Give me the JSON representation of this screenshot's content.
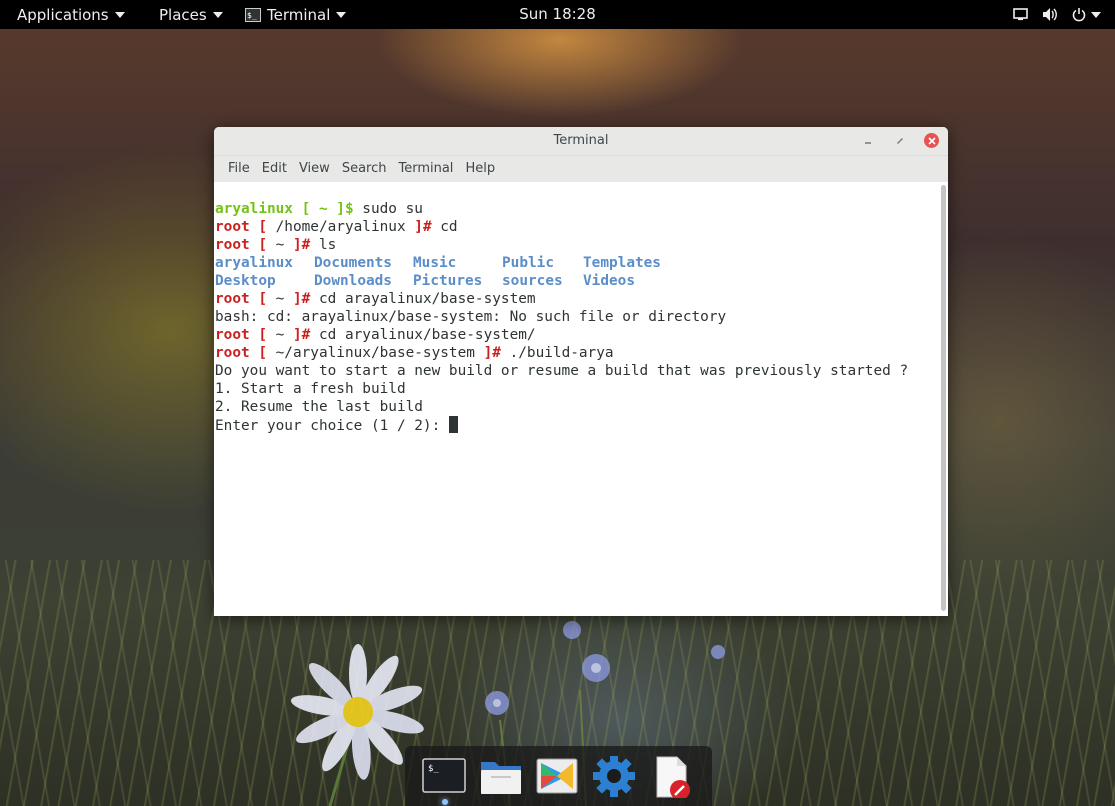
{
  "topbar": {
    "applications": "Applications",
    "places": "Places",
    "app_name": "Terminal",
    "clock": "Sun 18:28",
    "tray_icons": [
      "display-icon",
      "volume-icon",
      "power-icon"
    ]
  },
  "window": {
    "title": "Terminal",
    "menu": [
      "File",
      "Edit",
      "View",
      "Search",
      "Terminal",
      "Help"
    ]
  },
  "terminal": {
    "l1_user": "aryalinux",
    "l1_bracket": " [ ~ ]$",
    "l1_cmd": " sudo su",
    "root": "root",
    "open_br": " [",
    "close_br": "]#",
    "l2_path": " /home/aryalinux ",
    "l2_cmd": " cd",
    "home_path": " ~ ",
    "l3_cmd": " ls",
    "ls_row1": [
      "aryalinux",
      "Documents",
      "Music",
      "Public",
      "Templates"
    ],
    "ls_row2": [
      "Desktop",
      "Downloads",
      "Pictures",
      "sources",
      "Videos"
    ],
    "l6_cmd": " cd arayalinux/base-system",
    "l7_err": "bash: cd: arayalinux/base-system: No such file or directory",
    "l8_cmd": " cd aryalinux/base-system/",
    "l9_path": " ~/aryalinux/base-system ",
    "l9_cmd": " ./build-arya",
    "q": "Do you want to start a new build or resume a build that was previously started ?",
    "opt1": "1. Start a fresh build",
    "opt2": "2. Resume the last build",
    "prompt": "Enter your choice (1 / 2): "
  },
  "dock": {
    "items": [
      "terminal-icon",
      "files-icon",
      "software-icon",
      "settings-icon",
      "text-editor-icon"
    ],
    "terminal_glyph": "$_"
  },
  "colors": {
    "user_green": "#73c314",
    "root_red": "#cc1f1f",
    "dir_blue": "#5b8dc8",
    "close_red": "#e55353"
  }
}
